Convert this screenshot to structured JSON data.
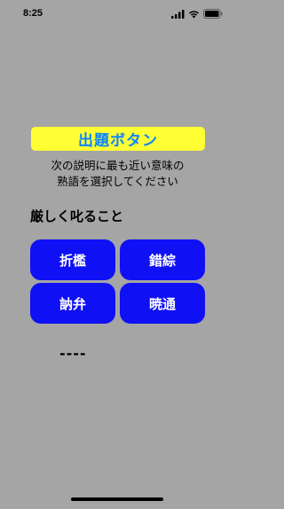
{
  "status_bar": {
    "time": "8:25"
  },
  "question_button": {
    "label": "出題ボタン",
    "background": "#ffff33",
    "text_color": "#0a84ff"
  },
  "instruction": {
    "line1": "次の説明に最も近い意味の",
    "line2": "熟語を選択してください"
  },
  "definition": "厳しく叱ること",
  "choices": [
    {
      "label": "折檻"
    },
    {
      "label": "錯綜"
    },
    {
      "label": "訥弁"
    },
    {
      "label": "暁通"
    }
  ],
  "choice_color": "#1010f5",
  "result": "----",
  "background": "#a5a5a5"
}
